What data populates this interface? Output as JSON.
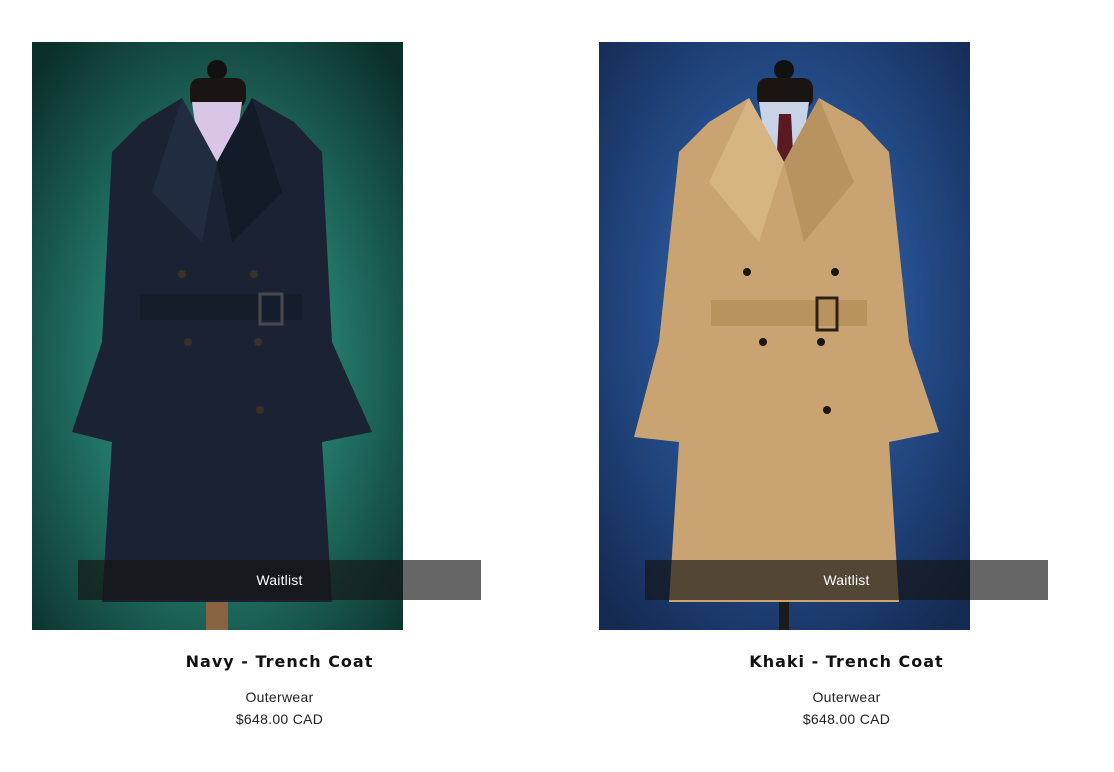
{
  "products": [
    {
      "title": "Navy - Trench Coat",
      "category": "Outerwear",
      "price": "$648.00 CAD",
      "waitlist_label": "Waitlist",
      "image": {
        "subject": "navy-trench-coat-on-mannequin",
        "background_color": "#1f6b5f",
        "coat_color": "#1a2233"
      }
    },
    {
      "title": "Khaki - Trench Coat",
      "category": "Outerwear",
      "price": "$648.00 CAD",
      "waitlist_label": "Waitlist",
      "image": {
        "subject": "khaki-trench-coat-on-mannequin",
        "background_color": "#234a86",
        "coat_color": "#c9a472"
      }
    }
  ]
}
